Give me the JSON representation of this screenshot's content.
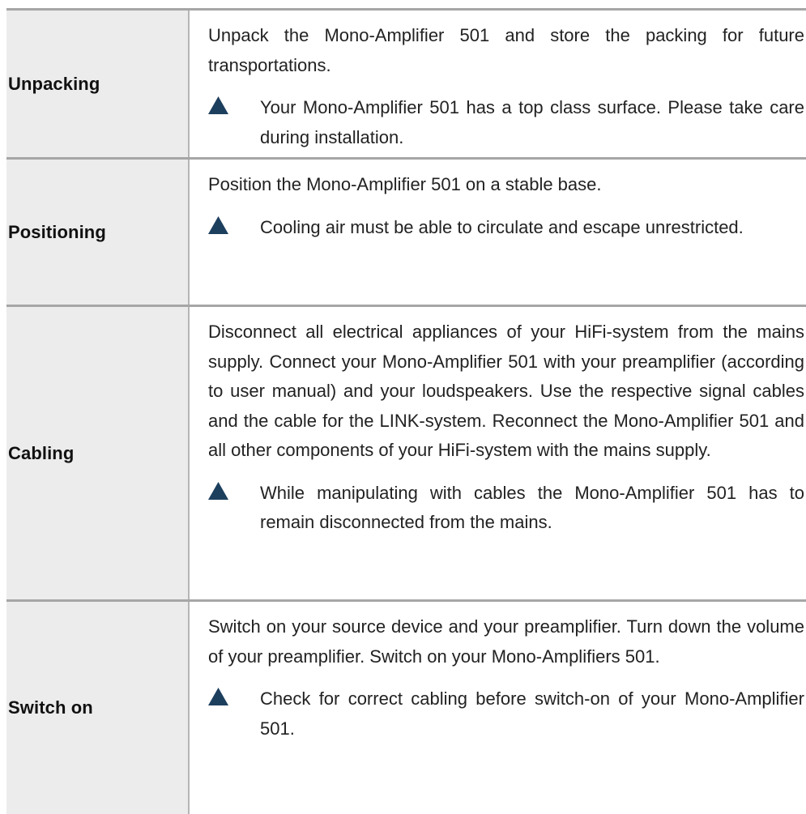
{
  "icon_color": "#1d3f5e",
  "sections": [
    {
      "label": "Unpacking",
      "paragraph": "Unpack the Mono-Amplifier 501 and store the packing for fu­ture transportations.",
      "warning_icon": "warning-triangle-icon",
      "warning": "Your Mono-Amplifier 501 has a top class surface. Please take care during installation."
    },
    {
      "label": "Positioning",
      "paragraph": "Position the Mono-Amplifier 501 on a stable base.",
      "warning_icon": "warning-triangle-icon",
      "warning": "Cooling air must be able to circulate and escape unre­stricted."
    },
    {
      "label": "Cabling",
      "paragraph": "Disconnect all electrical appliances of your HiFi-system from the mains supply. Connect your Mono-Amplifier 501 with your preamplifier (according to user manual) and your loudspeak­ers. Use the respective signal cables and the cable for the LINK-system. Reconnect the Mono-Amplifier 501 and all other components of your HiFi-system with the mains supply.",
      "warning_icon": "warning-triangle-icon",
      "warning": "While manipulating with cables the Mono-Amplifier 501 has to remain disconnected from the mains."
    },
    {
      "label": "Switch on",
      "paragraph": "Switch on your source device and your preamplifier. Turn down the volume of your preamplifier. Switch on your Mono-Amplifiers 501.",
      "warning_icon": "warning-triangle-icon",
      "warning": "Check for correct cabling before switch-on of your Mono-Amplifier 501."
    }
  ]
}
